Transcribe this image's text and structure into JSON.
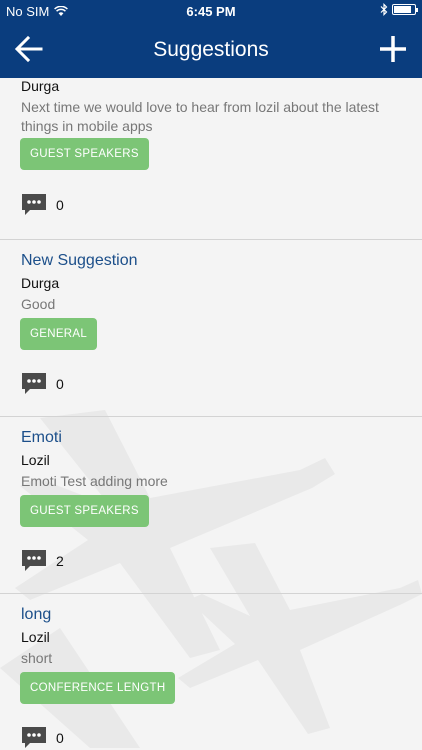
{
  "status_bar": {
    "carrier": "No SIM",
    "time": "6:45 PM"
  },
  "header": {
    "title": "Suggestions"
  },
  "suggestions": [
    {
      "title": "",
      "author": "Durga",
      "body": "Next time we would love to hear from lozil about the latest things in mobile apps",
      "tag": "GUEST SPEAKERS",
      "comments": "0"
    },
    {
      "title": "New Suggestion",
      "author": "Durga",
      "body": "Good",
      "tag": "GENERAL",
      "comments": "0"
    },
    {
      "title": "Emoti",
      "author": "Lozil",
      "body": "Emoti Test adding more",
      "tag": "GUEST SPEAKERS",
      "comments": "2"
    },
    {
      "title": "long",
      "author": "Lozil",
      "body": "short",
      "tag": "CONFERENCE LENGTH",
      "comments": "0"
    }
  ],
  "colors": {
    "header": "#0a3d7e",
    "tag": "#7cc576",
    "title": "#1c4f8a"
  },
  "icons": {
    "back": "arrow-left-icon",
    "add": "plus-icon",
    "comment": "speech-bubble-icon"
  }
}
